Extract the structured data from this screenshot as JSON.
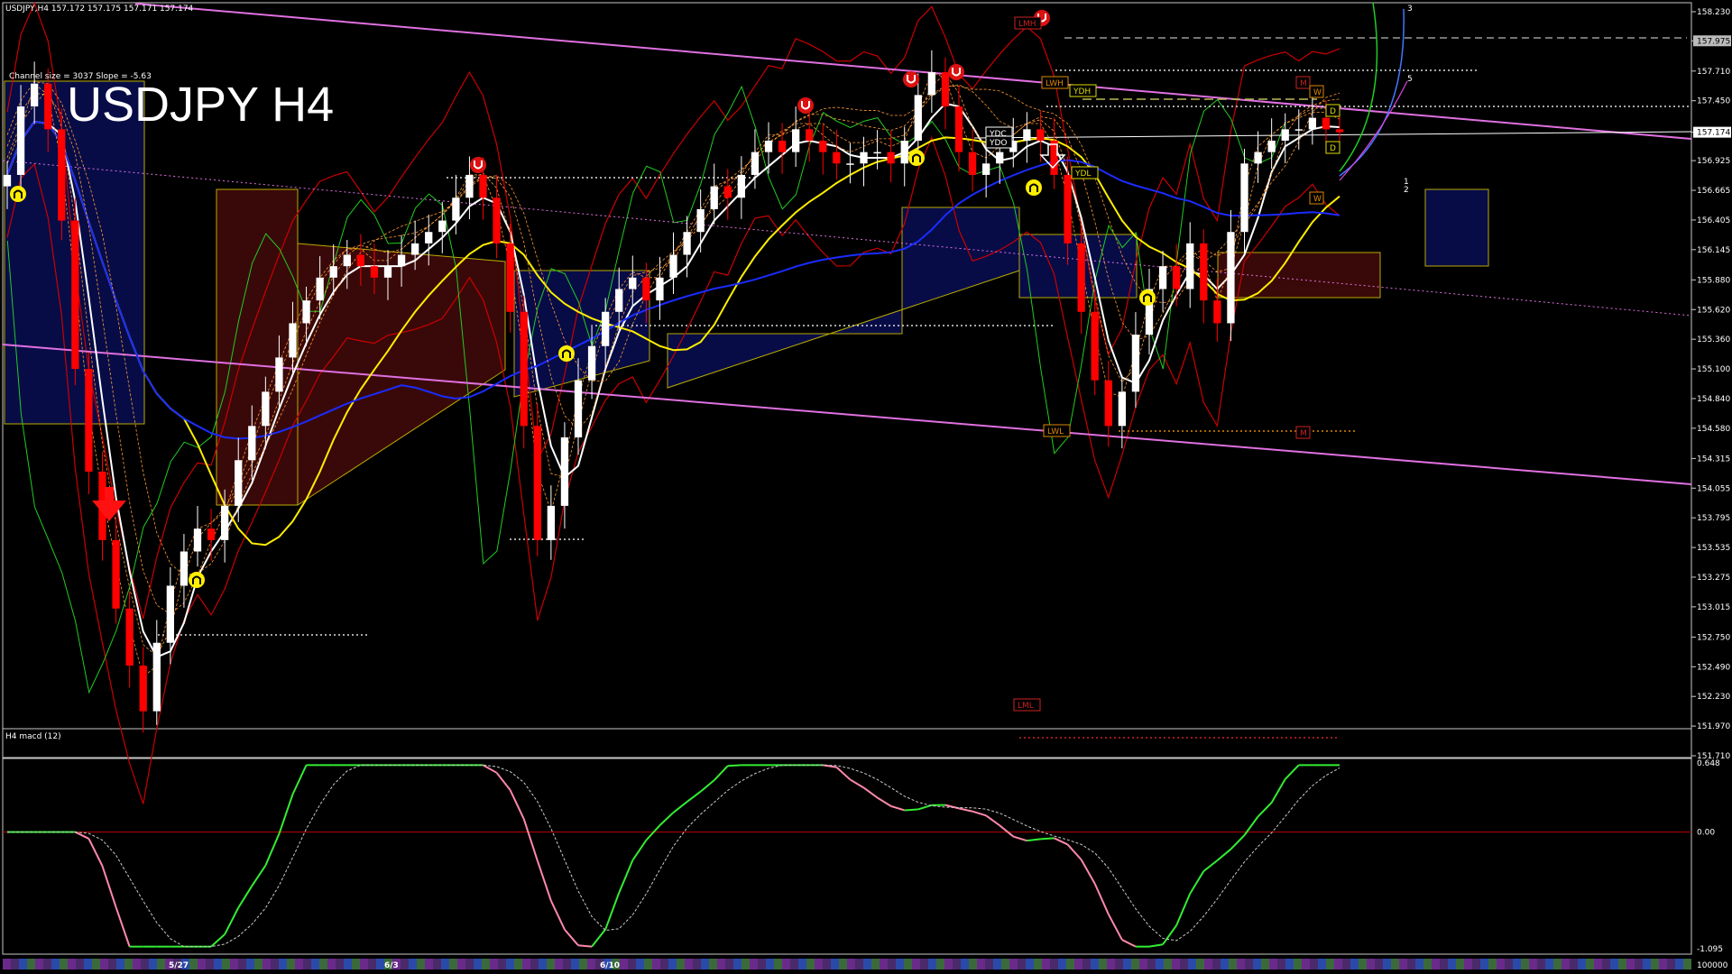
{
  "window": {
    "header": "USDJPY,H4  157.172 157.175 157.171 157.174",
    "channel_info": "Channel size = 3037 Slope = -5.63"
  },
  "chart_title": "USDJPY H4",
  "colors": {
    "background": "#000000",
    "bull_candle": "#ffffff",
    "bear_candle": "#ff0000",
    "sma_fast": "#ffffff",
    "sma_mid": "#ffee00",
    "sma_slow": "#1a2cff",
    "channel": "#e070e0",
    "bollinger": "#cc0000",
    "chikou": "#22cc22",
    "macd_up": "#33ee33",
    "macd_down": "#ff88aa",
    "signal": "#cccccc",
    "current_price_label_bg": "#ffffff"
  },
  "price_axis": {
    "labels": [
      "158.230",
      "157.975",
      "157.710",
      "157.450",
      "157.174",
      "156.925",
      "156.665",
      "156.405",
      "156.145",
      "155.880",
      "155.620",
      "155.360",
      "155.100",
      "154.840",
      "154.580",
      "154.315",
      "154.055",
      "153.795",
      "153.535",
      "153.275",
      "153.015",
      "152.750",
      "152.490",
      "152.230",
      "151.970",
      "151.710"
    ],
    "current_price": "157.174",
    "highlight_price": "157.975",
    "ylim": [
      151.71,
      158.23
    ]
  },
  "macd": {
    "label": "H4  macd (12)",
    "axis_labels": [
      "0.648",
      "0.00",
      "-1.095"
    ],
    "ylim": [
      -1.095,
      0.648
    ]
  },
  "time_axis": {
    "labels": [
      "5/27",
      "6/3",
      "6/10"
    ],
    "volume_label": "100000"
  },
  "levels": {
    "LMH": "LMH",
    "LWH": "LWH",
    "YDH": "YDH",
    "YDC": "YDC",
    "YDO": "YDO",
    "YDL": "YDL",
    "LWL": "LWL",
    "LML": "LML",
    "M": "M",
    "W": "W",
    "D": "D"
  },
  "projection_labels": [
    "3",
    "5",
    "1",
    "2"
  ],
  "chart_data": {
    "type": "candlestick",
    "title": "USDJPY H4",
    "ylim": [
      151.71,
      158.23
    ],
    "series_close": [
      156.8,
      157.4,
      157.6,
      157.2,
      156.4,
      155.1,
      154.2,
      153.6,
      153.0,
      152.5,
      152.1,
      152.7,
      153.2,
      153.5,
      153.7,
      153.6,
      153.9,
      154.3,
      154.6,
      154.9,
      155.2,
      155.5,
      155.7,
      155.9,
      156.0,
      156.1,
      156.0,
      155.9,
      156.0,
      156.1,
      156.2,
      156.3,
      156.4,
      156.6,
      156.8,
      156.6,
      156.2,
      155.6,
      154.6,
      153.6,
      153.9,
      154.5,
      155.0,
      155.3,
      155.6,
      155.8,
      155.9,
      155.7,
      155.9,
      156.1,
      156.3,
      156.5,
      156.7,
      156.6,
      156.8,
      157.0,
      157.1,
      157.0,
      157.2,
      157.1,
      157.0,
      156.9,
      156.9,
      157.0,
      157.0,
      156.9,
      157.1,
      157.5,
      157.7,
      157.4,
      157.0,
      156.8,
      156.9,
      157.0,
      157.1,
      157.2,
      157.1,
      156.8,
      156.2,
      155.6,
      155.0,
      154.6,
      154.9,
      155.4,
      155.8,
      156.0,
      155.8,
      156.2,
      155.7,
      155.5,
      156.3,
      156.9,
      157.0,
      157.1,
      157.2,
      157.2,
      157.3,
      157.2,
      157.174
    ]
  }
}
